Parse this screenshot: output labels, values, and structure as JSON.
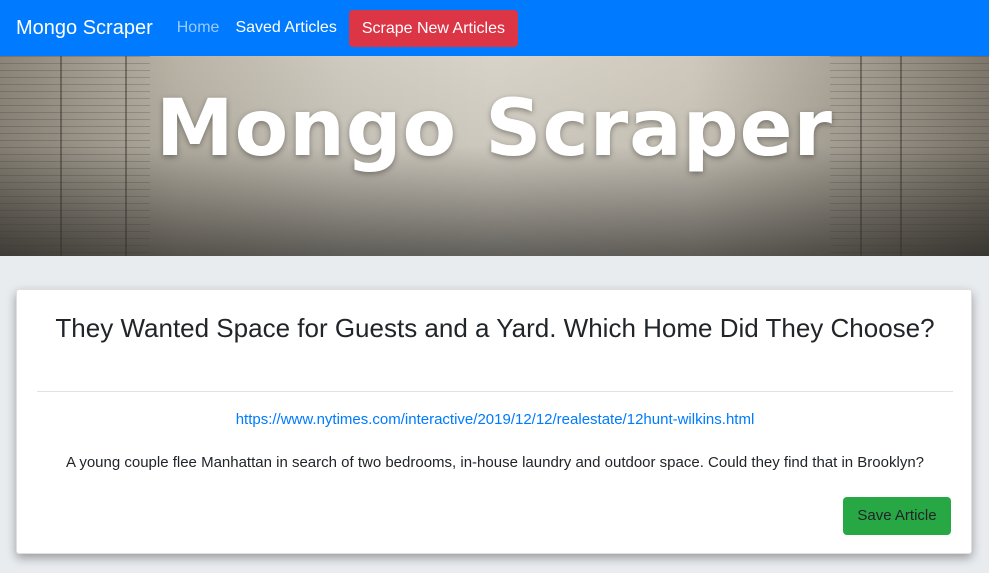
{
  "navbar": {
    "brand": "Mongo Scraper",
    "home_label": "Home",
    "saved_label": "Saved Articles",
    "scrape_label": "Scrape New Articles"
  },
  "hero": {
    "title": "Mongo Scraper"
  },
  "article": {
    "title": "They Wanted Space for Guests and a Yard. Which Home Did They Choose?",
    "link": "https://www.nytimes.com/interactive/2019/12/12/realestate/12hunt-wilkins.html",
    "summary": "A young couple flee Manhattan in search of two bedrooms, in-house laundry and outdoor space. Could they find that in Brooklyn?",
    "save_label": "Save Article"
  },
  "colors": {
    "navbar": "#007bff",
    "scrape_button": "#dc3545",
    "save_button": "#28a745",
    "link": "#007bff"
  }
}
